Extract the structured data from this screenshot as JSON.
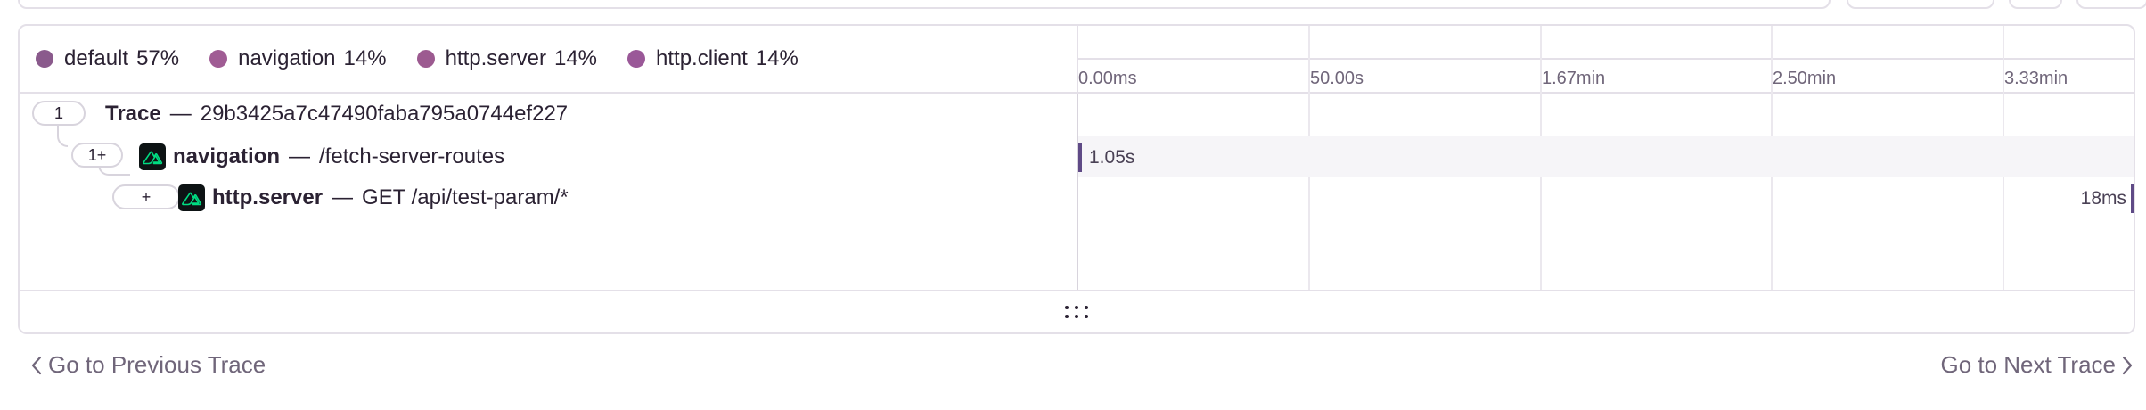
{
  "legend": [
    {
      "name": "default",
      "percent": "57%",
      "color": "#8a5a8c"
    },
    {
      "name": "navigation",
      "percent": "14%",
      "color": "#a05c94"
    },
    {
      "name": "http.server",
      "percent": "14%",
      "color": "#9c5a90"
    },
    {
      "name": "http.client",
      "percent": "14%",
      "color": "#9a5898"
    }
  ],
  "timeline": {
    "ticks": [
      "0.00ms",
      "50.00s",
      "1.67min",
      "2.50min",
      "3.33min"
    ]
  },
  "tree": {
    "trace": {
      "count": "1",
      "title": "Trace",
      "id": "29b3425a7c47490faba795a0744ef227"
    },
    "navigation": {
      "count": "1+",
      "op": "navigation",
      "description": "/fetch-server-routes",
      "duration": "1.05s",
      "icon": "nuxt-icon"
    },
    "http_server": {
      "count": "+",
      "op": "http.server",
      "description": "GET /api/test-param/*",
      "duration": "18ms",
      "icon": "nuxt-icon"
    }
  },
  "separator": "—",
  "nav": {
    "prev_label": "Go to Previous Trace",
    "next_label": "Go to Next Trace"
  },
  "colors": {
    "border": "#e4e0e8",
    "bar": "#5f4a86",
    "accent_green": "#00dc82"
  }
}
